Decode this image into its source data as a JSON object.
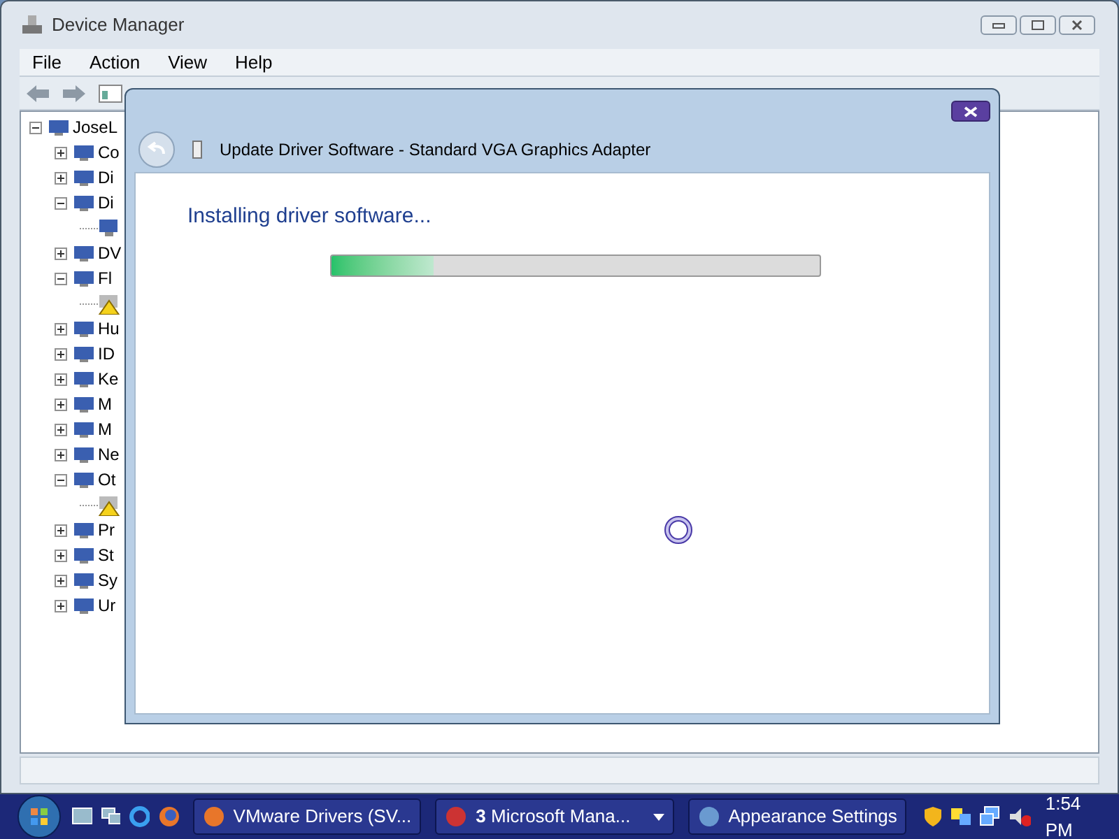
{
  "window": {
    "title": "Device Manager"
  },
  "menu": [
    "File",
    "Action",
    "View",
    "Help"
  ],
  "tree": [
    {
      "label": "JoseL",
      "expanded": true,
      "children": [
        {
          "label": "Co",
          "expanded": false
        },
        {
          "label": "Di",
          "expanded": false
        },
        {
          "label": "Di",
          "expanded": true,
          "children": [
            {
              "warning": false
            }
          ]
        },
        {
          "label": "DV",
          "expanded": false
        },
        {
          "label": "Fl",
          "expanded": true,
          "children": [
            {
              "warning": true
            }
          ]
        },
        {
          "label": "Hu",
          "expanded": false
        },
        {
          "label": "ID",
          "expanded": false
        },
        {
          "label": "Ke",
          "expanded": false
        },
        {
          "label": "M",
          "expanded": false
        },
        {
          "label": "M",
          "expanded": false
        },
        {
          "label": "Ne",
          "expanded": false
        },
        {
          "label": "Ot",
          "expanded": true,
          "children": [
            {
              "warning": true
            }
          ]
        },
        {
          "label": "Pr",
          "expanded": false
        },
        {
          "label": "St",
          "expanded": false
        },
        {
          "label": "Sy",
          "expanded": false
        },
        {
          "label": "Ur",
          "expanded": false
        }
      ]
    }
  ],
  "dialog": {
    "title": "Update Driver Software - Standard VGA Graphics Adapter",
    "heading": "Installing driver software...",
    "progress": {
      "level": 0.21
    }
  },
  "taskbar": {
    "buttons": [
      {
        "label": "VMware Drivers (SV...",
        "menu": false
      },
      {
        "label": "**3** Microsoft Mana...",
        "menu": true
      },
      {
        "label": "Appearance Settings",
        "menu": false
      }
    ],
    "clock": "1:54 PM"
  }
}
